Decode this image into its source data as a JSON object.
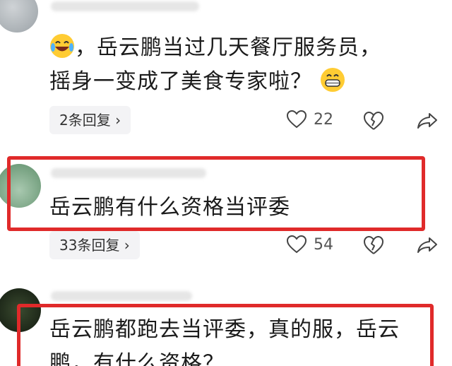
{
  "comments": [
    {
      "text_before_emoji": "，岳云鹏当过几天餐厅服务员，摇身一变成了美食专家啦？",
      "leading_emoji": "laughing-tears-emoji",
      "trailing_emoji": "grinning-emoji",
      "replies_label": "2条回复 ›",
      "like_count": "22"
    },
    {
      "text": "岳云鹏有什么资格当评委",
      "replies_label": "33条回复 ›",
      "like_count": "54"
    },
    {
      "text": "岳云鹏都跑去当评委，真的服，岳云鹏，有什么资格？"
    }
  ],
  "colors": {
    "highlight": "#e02a2a",
    "chip_bg": "#f3f3f5"
  }
}
